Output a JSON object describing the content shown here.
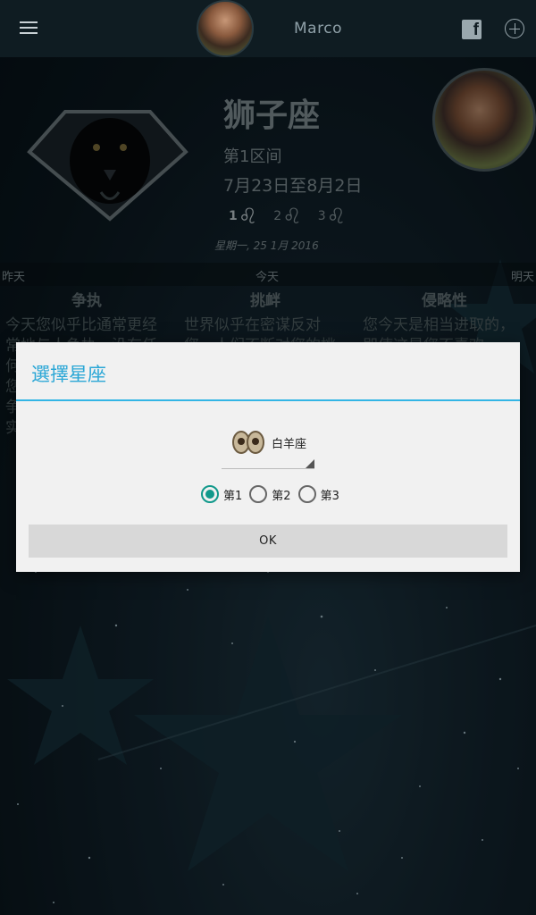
{
  "topbar": {
    "user_name": "Marco",
    "menu_icon": "menu-icon",
    "facebook_icon": "facebook-icon",
    "add_icon": "add-circle-icon"
  },
  "sign": {
    "name": "狮子座",
    "range": "第1区间",
    "dates": "7月23日至8月2日",
    "decans": [
      {
        "num": "1",
        "glyph": "♌"
      },
      {
        "num": "2",
        "glyph": "♌"
      },
      {
        "num": "3",
        "glyph": "♌"
      }
    ],
    "date_line": "星期一, 25 1月 2016"
  },
  "days": {
    "yesterday": "昨天",
    "today": "今天",
    "tomorrow": "明天"
  },
  "columns": [
    {
      "title": "争执",
      "text": "今天您似乎比通常更经常地与人争执，没有任何人能够阻止您，能让您停下来……山一样的争吵……满足的结果，实际上……原因。"
    },
    {
      "title": "挑衅",
      "text": "世界似乎在密谋反对您，人们不断对您的挑"
    },
    {
      "title": "侵略性",
      "text": "您今天是相当进取的，即使这是您不喜欢"
    }
  ],
  "dialog": {
    "title": "選擇星座",
    "selected_sign": "白羊座",
    "radio_options": [
      {
        "label": "第1",
        "checked": true
      },
      {
        "label": "第2",
        "checked": false
      },
      {
        "label": "第3",
        "checked": false
      }
    ],
    "ok_label": "OK"
  },
  "colors": {
    "accent": "#33b5e5",
    "radio_checked": "#11998b",
    "topbar_bg": "#0f1c22"
  }
}
